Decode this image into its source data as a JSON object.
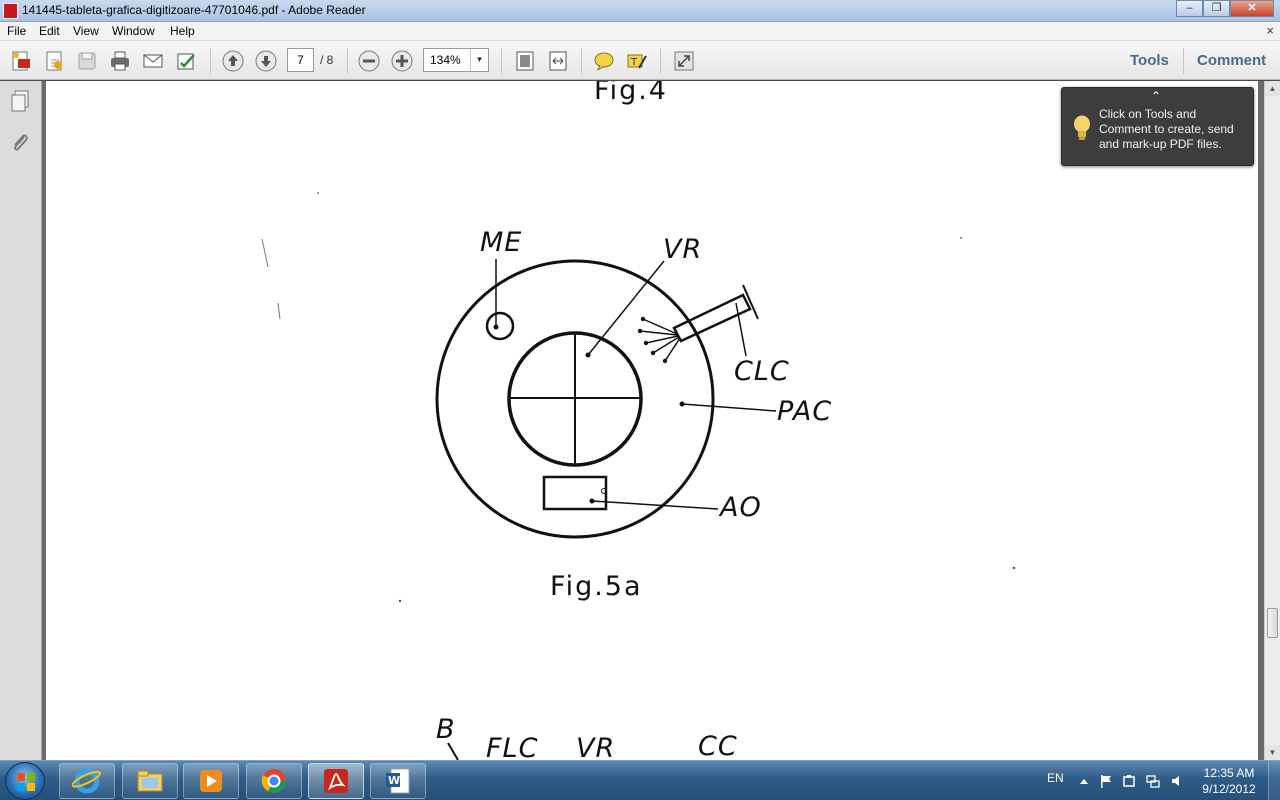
{
  "window": {
    "title": "141445-tableta-grafica-digitizoare-47701046.pdf - Adobe Reader",
    "minimize_glyph": "–",
    "maximize_glyph": "❐",
    "close_glyph": "✕"
  },
  "menu": {
    "items": [
      "File",
      "Edit",
      "View",
      "Window",
      "Help"
    ],
    "close_glyph": "×"
  },
  "toolbar": {
    "current_page": "7",
    "total_pages": "/ 8",
    "zoom": "134%",
    "zoom_arrow": "▼",
    "tools_label": "Tools",
    "comment_label": "Comment",
    "accent_color": "#4a6a8c"
  },
  "tooltip": {
    "caret": "⌃",
    "text": "Click on Tools and Comment to create, send and mark-up PDF files."
  },
  "document": {
    "fig4_caption": "Fig.4",
    "fig5a_caption": "Fig.5a",
    "labels": {
      "me": "ME",
      "vr": "VR",
      "clc": "CLC",
      "pac": "PAC",
      "ao": "AO",
      "b": "B",
      "flc": "FLC",
      "vr2": "VR",
      "cc": "CC"
    }
  },
  "scrollbar": {
    "up": "▲",
    "down": "▼"
  },
  "taskbar": {
    "apps": [
      "start",
      "internet-explorer",
      "windows-explorer",
      "media-player",
      "chrome",
      "adobe-reader",
      "word"
    ],
    "language": "EN",
    "time": "12:35 AM",
    "date": "9/12/2012"
  }
}
